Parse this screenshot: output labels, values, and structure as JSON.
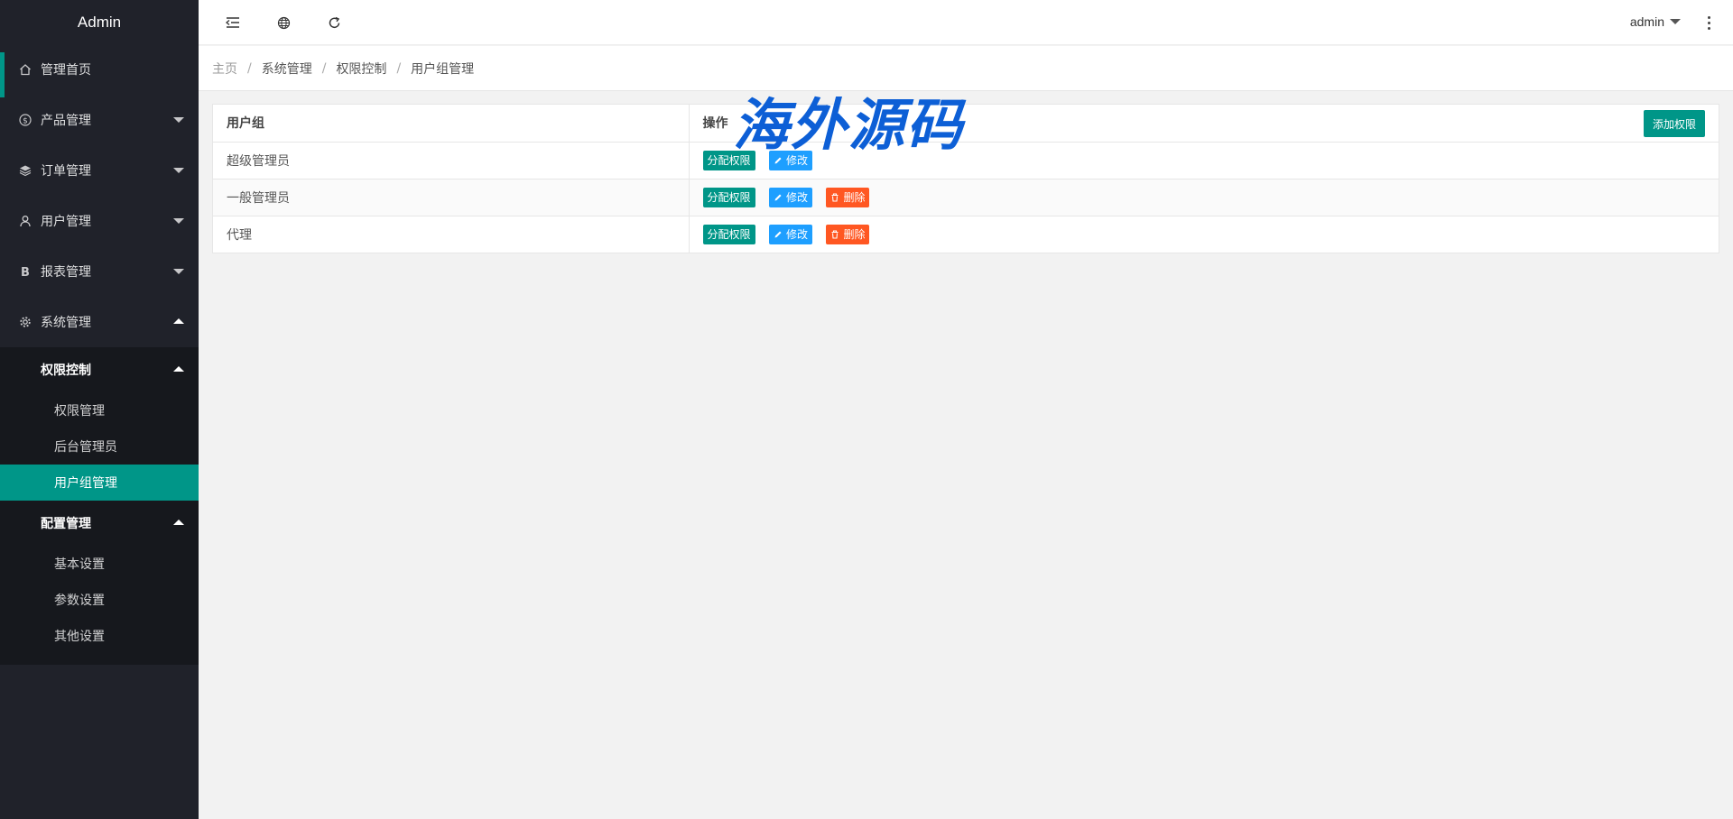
{
  "app": {
    "title": "Admin"
  },
  "sidebar": {
    "items": [
      {
        "label": "管理首页",
        "icon": "home-icon"
      },
      {
        "label": "产品管理",
        "icon": "dollar-icon"
      },
      {
        "label": "订单管理",
        "icon": "layers-icon"
      },
      {
        "label": "用户管理",
        "icon": "user-icon"
      },
      {
        "label": "报表管理",
        "icon": "b-letter-icon"
      },
      {
        "label": "系统管理",
        "icon": "gear-icon"
      }
    ],
    "groups": [
      {
        "label": "权限控制",
        "children": [
          "权限管理",
          "后台管理员",
          "用户组管理"
        ]
      },
      {
        "label": "配置管理",
        "children": [
          "基本设置",
          "参数设置",
          "其他设置"
        ]
      }
    ],
    "selected": "用户组管理"
  },
  "header": {
    "user": "admin"
  },
  "breadcrumb": [
    "主页",
    "系统管理",
    "权限控制",
    "用户组管理"
  ],
  "table": {
    "headers": [
      "用户组",
      "操作"
    ],
    "add_button": "添加权限",
    "rows": [
      {
        "name": "超级管理员"
      },
      {
        "name": "一般管理员"
      },
      {
        "name": "代理"
      }
    ],
    "actions": {
      "assign": "分配权限",
      "edit": "修改",
      "delete": "删除"
    }
  },
  "watermark": "海外源码",
  "colors": {
    "accent": "#009688",
    "edit": "#1e9fff",
    "delete": "#ff5722",
    "sidebar": "#20222a"
  }
}
